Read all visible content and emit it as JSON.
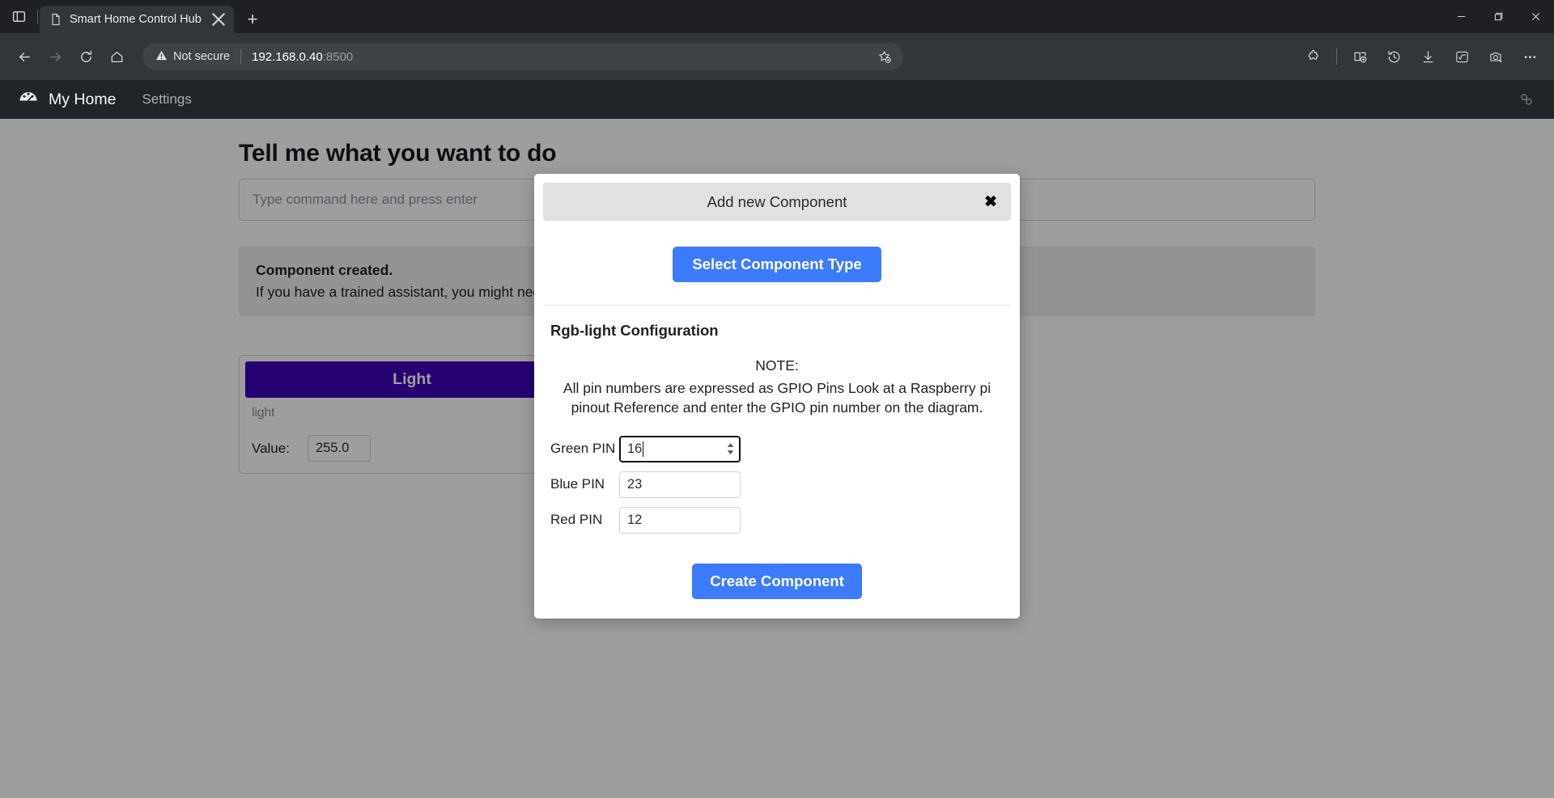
{
  "browser": {
    "tab": {
      "title": "Smart Home Control Hub",
      "favicon_icon": "page-icon",
      "close_icon": "close-icon"
    },
    "new_tab_label": "+",
    "tab_strip_icon": "tab-list-icon",
    "nav": {
      "back_icon": "back-arrow-icon",
      "forward_icon": "forward-arrow-icon",
      "reload_icon": "reload-icon",
      "home_icon": "home-icon"
    },
    "omnibox": {
      "security_icon": "warning-triangle-icon",
      "security_label": "Not secure",
      "url_host": "192.168.0.40",
      "url_port": ":8500",
      "favorite_icon": "star-plus-icon"
    },
    "toolbar_right": [
      {
        "name": "extensions-icon",
        "label": "Extensions"
      },
      {
        "name": "collections-icon",
        "label": "Collections"
      },
      {
        "name": "history-icon",
        "label": "History"
      },
      {
        "name": "downloads-icon",
        "label": "Downloads"
      },
      {
        "name": "math-solver-icon",
        "label": "Math Solver"
      },
      {
        "name": "screenshot-icon",
        "label": "Web capture"
      },
      {
        "name": "more-options-icon",
        "label": "Settings and more"
      }
    ],
    "window_controls": {
      "minimize_icon": "minimize-icon",
      "maximize_icon": "restore-icon",
      "close_icon": "window-close-icon"
    }
  },
  "app": {
    "navbar": {
      "brand_icon": "dashboard-gauge-icon",
      "brand_label": "My Home",
      "settings_label": "Settings",
      "right_icon": "link-chain-icon"
    },
    "page_title": "Tell me what you want to do",
    "command_input_placeholder": "Type command here and press enter",
    "command_input_value": "",
    "alert": {
      "title": "Component created.",
      "message": "If you have a trained assistant, you might need to retrain it."
    },
    "device_card": {
      "header": "Light",
      "subtitle": "light",
      "value_label": "Value:",
      "value": "255.0",
      "header_color": "#3d00b7"
    },
    "side_panel_color": "#8f96ab"
  },
  "modal": {
    "title": "Add new Component",
    "close_icon": "modal-close-icon",
    "close_label": "✖",
    "select_type_button": "Select Component Type",
    "config_heading": "Rgb-light Configuration",
    "note_label": "NOTE:",
    "note_text": "All pin numbers are expressed as GPIO Pins Look at a Raspberry pi pinout Reference and enter the GPIO pin number on the diagram.",
    "fields": [
      {
        "label": "Green PIN",
        "value": "16",
        "focused": true,
        "type": "number"
      },
      {
        "label": "Blue PIN",
        "value": "23",
        "focused": false,
        "type": "number"
      },
      {
        "label": "Red PIN",
        "value": "12",
        "focused": false,
        "type": "number"
      }
    ],
    "create_button": "Create Component",
    "accent_color": "#3d7bfd"
  }
}
